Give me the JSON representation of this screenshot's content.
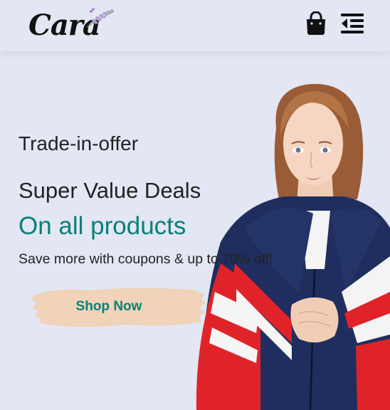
{
  "header": {
    "logo_text": "Cara",
    "icons": [
      "shopping-bag-icon",
      "menu-icon"
    ]
  },
  "hero": {
    "eyebrow": "Trade-in-offer",
    "heading": "Super Value Deals",
    "highlight": "On all products",
    "description": "Save more with coupons & up to 70% off!",
    "button_label": "Shop Now"
  },
  "colors": {
    "background": "#e3e6f3",
    "accent": "#088178",
    "button_brush": "#f0d3b8",
    "text": "#222222"
  }
}
